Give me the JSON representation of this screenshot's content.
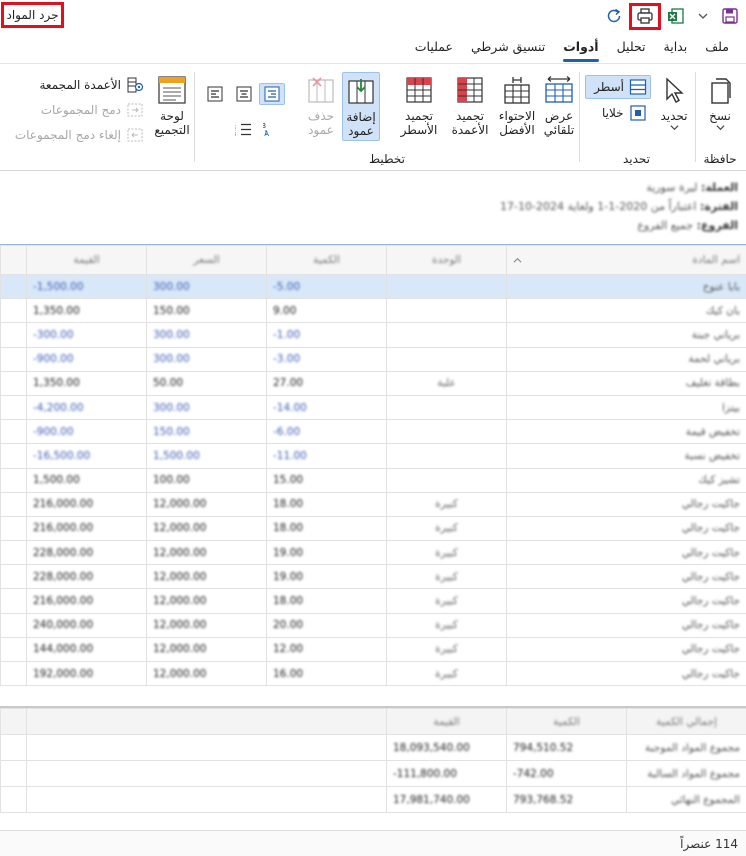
{
  "window": {
    "title": "جرد المواد"
  },
  "tabs": [
    {
      "label": "ملف",
      "active": false
    },
    {
      "label": "بداية",
      "active": false
    },
    {
      "label": "تحليل",
      "active": false
    },
    {
      "label": "أدوات",
      "active": true
    },
    {
      "label": "تنسيق شرطي",
      "active": false
    },
    {
      "label": "عمليات",
      "active": false
    }
  ],
  "ribbon": {
    "clipboard": {
      "group_label": "حافظة",
      "copy_label": "نسخ"
    },
    "selection": {
      "group_label": "تحديد",
      "select_label": "تحديد",
      "rows_label": "أسطر",
      "cells_label": "خلايا"
    },
    "layout": {
      "group_label": "تخطيط",
      "autofit_label": "عرض تلقائي",
      "bestfit_label": "الاحتواء الأفضل",
      "freeze_columns_label": "تجميد الأعمدة",
      "freeze_rows_label": "تجميد الأسطر",
      "add_column_label": "إضافة عمود",
      "delete_column_label": "حذف عمود"
    },
    "grouping": {
      "panel_label": "لوحة التجميع",
      "grouped_columns_label": "الأعمدة المجمعة",
      "merge_groups_label": "دمج المجموعات",
      "unmerge_groups_label": "إلغاء دمج المجموعات"
    }
  },
  "filter": {
    "currency_label": "العملة:",
    "currency_value": "ليرة سورية",
    "period_label": "الفترة:",
    "period_value": "اعتباراً من 2020-1-1 ولغاية 2024-10-17",
    "branches_label": "الفروع:",
    "branches_value": "جميع الفروع"
  },
  "grid": {
    "columns": [
      "اسم المادة",
      "الوحدة",
      "الكمية",
      "السعر",
      "القيمة"
    ],
    "rows": [
      {
        "name": "بابا عنوخ",
        "unit": "",
        "qty": "-5.00",
        "price": "300.00",
        "value": "-1,500.00",
        "neg": true
      },
      {
        "name": "بان كيك",
        "unit": "",
        "qty": "9.00",
        "price": "150.00",
        "value": "1,350.00",
        "neg": false
      },
      {
        "name": "برياني جبنة",
        "unit": "",
        "qty": "-1.00",
        "price": "300.00",
        "value": "-300.00",
        "neg": true
      },
      {
        "name": "برياني لحمة",
        "unit": "",
        "qty": "-3.00",
        "price": "300.00",
        "value": "-900.00",
        "neg": true
      },
      {
        "name": "بطاقة تغليف",
        "unit": "علبة",
        "qty": "27.00",
        "price": "50.00",
        "value": "1,350.00",
        "neg": false
      },
      {
        "name": "بيتزا",
        "unit": "",
        "qty": "-14.00",
        "price": "300.00",
        "value": "-4,200.00",
        "neg": true
      },
      {
        "name": "تخفيض قيمة",
        "unit": "",
        "qty": "-6.00",
        "price": "150.00",
        "value": "-900.00",
        "neg": true
      },
      {
        "name": "تخفيض نسبة",
        "unit": "",
        "qty": "-11.00",
        "price": "1,500.00",
        "value": "-16,500.00",
        "neg": true
      },
      {
        "name": "تشيز كيك",
        "unit": "",
        "qty": "15.00",
        "price": "100.00",
        "value": "1,500.00",
        "neg": false
      },
      {
        "name": "جاكيت رجالي",
        "unit": "كبيرة",
        "qty": "18.00",
        "price": "12,000.00",
        "value": "216,000.00",
        "neg": false
      },
      {
        "name": "جاكيت رجالي",
        "unit": "كبيرة",
        "qty": "18.00",
        "price": "12,000.00",
        "value": "216,000.00",
        "neg": false
      },
      {
        "name": "جاكيت رجالي",
        "unit": "كبيرة",
        "qty": "19.00",
        "price": "12,000.00",
        "value": "228,000.00",
        "neg": false
      },
      {
        "name": "جاكيت رجالي",
        "unit": "كبيرة",
        "qty": "19.00",
        "price": "12,000.00",
        "value": "228,000.00",
        "neg": false
      },
      {
        "name": "جاكيت رجالي",
        "unit": "كبيرة",
        "qty": "18.00",
        "price": "12,000.00",
        "value": "216,000.00",
        "neg": false
      },
      {
        "name": "جاكيت رجالي",
        "unit": "كبيرة",
        "qty": "20.00",
        "price": "12,000.00",
        "value": "240,000.00",
        "neg": false
      },
      {
        "name": "جاكيت رجالي",
        "unit": "كبيرة",
        "qty": "12.00",
        "price": "12,000.00",
        "value": "144,000.00",
        "neg": false
      },
      {
        "name": "جاكيت رجالي",
        "unit": "كبيرة",
        "qty": "16.00",
        "price": "12,000.00",
        "value": "192,000.00",
        "neg": false
      }
    ]
  },
  "summary": {
    "columns": [
      "إجمالي الكمية",
      "الكمية",
      "القيمة"
    ],
    "rows": [
      {
        "label": "مجموع المواد الموجبة",
        "qty": "794,510.52",
        "value": "18,093,540.00"
      },
      {
        "label": "مجموع المواد السالبة",
        "qty": "-742.00",
        "value": "-111,800.00"
      },
      {
        "label": "المجموع النهائي",
        "qty": "793,768.52",
        "value": "17,981,740.00"
      }
    ]
  },
  "status": {
    "count_text": "114 عنصراً"
  },
  "colors": {
    "accent": "#1f5fb0",
    "highlight": "#e0101e",
    "selected_row": "#d9e8f8",
    "negative": "#3a5db5"
  }
}
